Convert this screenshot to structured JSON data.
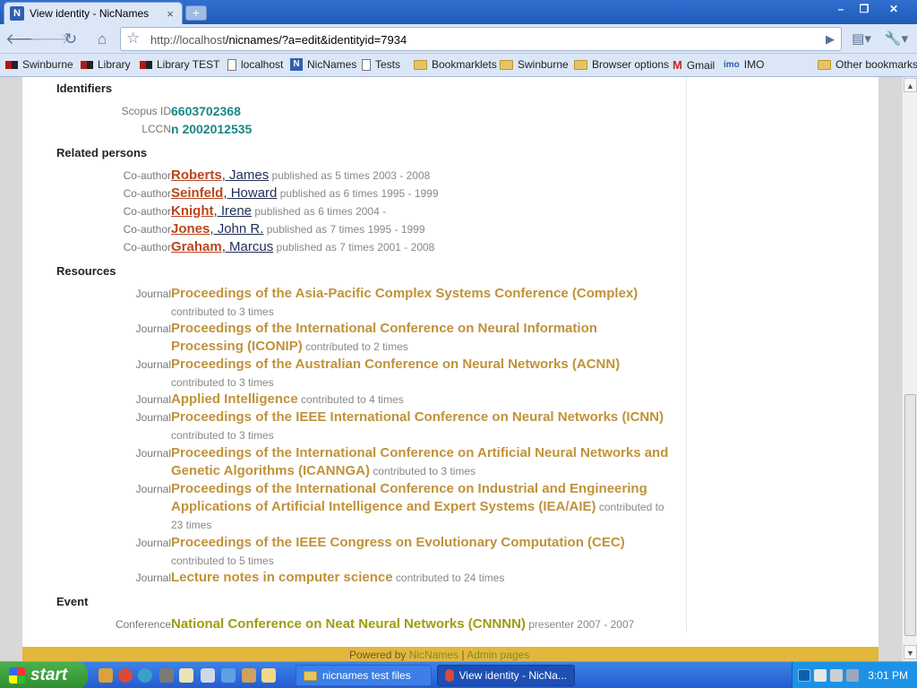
{
  "browser": {
    "tab_title": "View identity - NicNames",
    "tab_favicon": "N",
    "tab_close": "×",
    "new_tab": "+",
    "url_host": "http://localhost",
    "url_path": "/nicnames/?a=edit&identityid=7934",
    "window_controls": {
      "minimize": "–",
      "restore": "❐",
      "close": "✕"
    }
  },
  "bookmarks": [
    {
      "label": "Swinburne",
      "icon": "swinburne-logo-icon"
    },
    {
      "label": "Library",
      "icon": "swinburne-logo-icon"
    },
    {
      "label": "Library TEST",
      "icon": "swinburne-logo-icon"
    },
    {
      "label": "localhost",
      "icon": "page-icon"
    },
    {
      "label": "NicNames",
      "icon": "nicnames-icon"
    },
    {
      "label": "Tests",
      "icon": "page-icon"
    },
    {
      "label": "Bookmarklets",
      "icon": "folder-icon"
    },
    {
      "label": "Swinburne",
      "icon": "folder-icon"
    },
    {
      "label": "Browser options",
      "icon": "folder-icon"
    },
    {
      "label": "Gmail",
      "icon": "gmail-icon"
    },
    {
      "label": "IMO",
      "icon": "imo-icon"
    },
    {
      "label": "Other bookmarks",
      "icon": "folder-icon"
    }
  ],
  "identifiers": {
    "heading": "Identifiers",
    "items": [
      {
        "label": "Scopus ID",
        "value": "6603702368"
      },
      {
        "label": "LCCN",
        "value": "n 2002012535"
      }
    ]
  },
  "related": {
    "heading": "Related persons",
    "items": [
      {
        "label": "Co-author",
        "surname": "Roberts",
        "given": ", James",
        "note": " published as 5 times 2003 - 2008"
      },
      {
        "label": "Co-author",
        "surname": "Seinfeld",
        "given": ", Howard",
        "note": " published as 6 times 1995 - 1999"
      },
      {
        "label": "Co-author",
        "surname": "Knight",
        "given": ", Irene",
        "note": " published as 6 times 2004 -"
      },
      {
        "label": "Co-author",
        "surname": "Jones",
        "given": ", John R.",
        "note": " published as 7 times 1995 - 1999"
      },
      {
        "label": "Co-author",
        "surname": "Graham",
        "given": ", Marcus",
        "note": " published as 7 times 2001 - 2008"
      }
    ]
  },
  "resources": {
    "heading": "Resources",
    "items": [
      {
        "label": "Journal",
        "title": "Proceedings of the Asia-Pacific Complex Systems Conference (Complex)",
        "note": " contributed to 3 times"
      },
      {
        "label": "Journal",
        "title": "Proceedings of the International Conference on Neural Information Processing (ICONIP)",
        "note": " contributed to 2 times"
      },
      {
        "label": "Journal",
        "title": "Proceedings of the Australian Conference on Neural Networks (ACNN)",
        "note": " contributed to 3 times"
      },
      {
        "label": "Journal",
        "title": "Applied Intelligence",
        "note": " contributed to 4 times"
      },
      {
        "label": "Journal",
        "title": "Proceedings of the IEEE International Conference on Neural Networks (ICNN)",
        "note": " contributed to 3 times"
      },
      {
        "label": "Journal",
        "title": "Proceedings of the International Conference on Artificial Neural Networks and Genetic Algorithms (ICANNGA)",
        "note": " contributed to 3 times"
      },
      {
        "label": "Journal",
        "title": "Proceedings of the International Conference on Industrial and Engineering Applications of Artificial Intelligence and Expert Systems (IEA/AIE)",
        "note": " contributed to 23 times"
      },
      {
        "label": "Journal",
        "title": "Proceedings of the IEEE Congress on Evolutionary Computation (CEC)",
        "note": " contributed to 5 times"
      },
      {
        "label": "Journal",
        "title": "Lecture notes in computer science",
        "note": " contributed to 24 times"
      }
    ]
  },
  "event": {
    "heading": "Event",
    "items": [
      {
        "label": "Conference",
        "title": "National Conference on Neat Neural Networks (CNNNN)",
        "note": " presenter 2007 - 2007"
      }
    ]
  },
  "footer": {
    "powered": "Powered by ",
    "nicnames": "NicNames",
    "sep": " | ",
    "admin": "Admin pages"
  },
  "taskbar": {
    "start": "start",
    "tasks": [
      {
        "label": "nicnames test files",
        "active": false
      },
      {
        "label": "View identity - NicNa...",
        "active": true
      }
    ],
    "time": "3:01 PM"
  },
  "colors": {
    "journal": "#c0923a",
    "surname": "#b9461d",
    "identifier": "#1a8686",
    "event": "#9d9d10",
    "footer": "#e3b73d"
  }
}
